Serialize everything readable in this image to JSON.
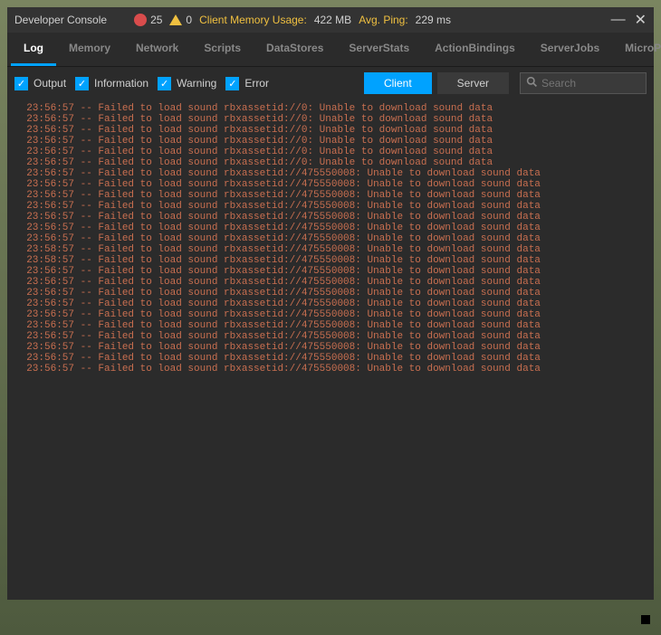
{
  "window": {
    "title": "Developer Console",
    "error_count": "25",
    "warn_count": "0",
    "mem_label": "Client Memory Usage:",
    "mem_value": "422 MB",
    "ping_label": "Avg. Ping:",
    "ping_value": "229 ms"
  },
  "tabs": {
    "items": [
      {
        "label": "Log"
      },
      {
        "label": "Memory"
      },
      {
        "label": "Network"
      },
      {
        "label": "Scripts"
      },
      {
        "label": "DataStores"
      },
      {
        "label": "ServerStats"
      },
      {
        "label": "ActionBindings"
      },
      {
        "label": "ServerJobs"
      },
      {
        "label": "MicroProfiler"
      }
    ],
    "active": 0
  },
  "filters": {
    "output": "Output",
    "information": "Information",
    "warning": "Warning",
    "error": "Error"
  },
  "mode": {
    "client": "Client",
    "server": "Server"
  },
  "search": {
    "placeholder": "Search"
  },
  "log": {
    "lines": [
      "  23:56:57 -- Failed to load sound rbxassetid://0: Unable to download sound data",
      "  23:56:57 -- Failed to load sound rbxassetid://0: Unable to download sound data",
      "  23:56:57 -- Failed to load sound rbxassetid://0: Unable to download sound data",
      "  23:56:57 -- Failed to load sound rbxassetid://0: Unable to download sound data",
      "  23:56:57 -- Failed to load sound rbxassetid://0: Unable to download sound data",
      "  23:56:57 -- Failed to load sound rbxassetid://0: Unable to download sound data",
      "  23:56:57 -- Failed to load sound rbxassetid://475550008: Unable to download sound data",
      "  23:56:57 -- Failed to load sound rbxassetid://475550008: Unable to download sound data",
      "  23:56:57 -- Failed to load sound rbxassetid://475550008: Unable to download sound data",
      "  23:56:57 -- Failed to load sound rbxassetid://475550008: Unable to download sound data",
      "  23:56:57 -- Failed to load sound rbxassetid://475550008: Unable to download sound data",
      "  23:56:57 -- Failed to load sound rbxassetid://475550008: Unable to download sound data",
      "  23:56:57 -- Failed to load sound rbxassetid://475550008: Unable to download sound data",
      "  23:58:57 -- Failed to load sound rbxassetid://475550008: Unable to download sound data",
      "  23:58:57 -- Failed to load sound rbxassetid://475550008: Unable to download sound data",
      "  23:56:57 -- Failed to load sound rbxassetid://475550008: Unable to download sound data",
      "  23:56:57 -- Failed to load sound rbxassetid://475550008: Unable to download sound data",
      "  23:56:57 -- Failed to load sound rbxassetid://475550008: Unable to download sound data",
      "  23:56:57 -- Failed to load sound rbxassetid://475550008: Unable to download sound data",
      "  23:56:57 -- Failed to load sound rbxassetid://475550008: Unable to download sound data",
      "  23:56:57 -- Failed to load sound rbxassetid://475550008: Unable to download sound data",
      "  23:56:57 -- Failed to load sound rbxassetid://475550008: Unable to download sound data",
      "  23:56:57 -- Failed to load sound rbxassetid://475550008: Unable to download sound data",
      "  23:56:57 -- Failed to load sound rbxassetid://475550008: Unable to download sound data",
      "  23:56:57 -- Failed to load sound rbxassetid://475550008: Unable to download sound data"
    ]
  }
}
